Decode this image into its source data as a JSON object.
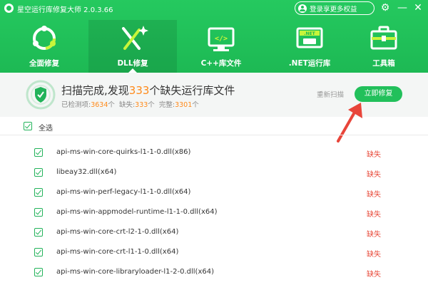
{
  "app": {
    "title": "星空运行库修复大师 2.0.3.66",
    "login_label": "登录享更多权益"
  },
  "nav": [
    {
      "label": "全面修复",
      "icon": "refresh-cycle-icon"
    },
    {
      "label": "DLL修复",
      "icon": "dll-magic-icon",
      "active": true
    },
    {
      "label": "C++库文件",
      "icon": "code-monitor-icon"
    },
    {
      "label": ".NET运行库",
      "icon": "net-monitor-icon"
    },
    {
      "label": "工具箱",
      "icon": "toolbox-icon"
    }
  ],
  "status": {
    "prefix": "扫描完成,发现",
    "count": "333",
    "suffix": "个缺失运行库文件",
    "detected_label": "已检测项:",
    "detected": "3634",
    "missing_label": "缺失:",
    "missing": "333",
    "complete_label": "完整:",
    "complete": "3301",
    "unit": "个"
  },
  "actions": {
    "rescan": "重新扫描",
    "fix_now": "立即修复"
  },
  "select_all": "全选",
  "files": [
    {
      "name": "api-ms-win-core-quirks-l1-1-0.dll(x86)",
      "status": "缺失"
    },
    {
      "name": "libeay32.dll(x64)",
      "status": "缺失"
    },
    {
      "name": "api-ms-win-perf-legacy-l1-1-0.dll(x64)",
      "status": "缺失"
    },
    {
      "name": "api-ms-win-appmodel-runtime-l1-1-0.dll(x64)",
      "status": "缺失"
    },
    {
      "name": "api-ms-win-core-crt-l2-1-0.dll(x64)",
      "status": "缺失"
    },
    {
      "name": "api-ms-win-core-crt-l1-1-0.dll(x64)",
      "status": "缺失"
    },
    {
      "name": "api-ms-win-core-libraryloader-l1-2-0.dll(x64)",
      "status": "缺失"
    }
  ],
  "colors": {
    "brand_green": "#22c05b",
    "highlight_orange": "#ff8a1a",
    "missing_red": "#e84a3a",
    "arrow_red": "#e8453a"
  }
}
